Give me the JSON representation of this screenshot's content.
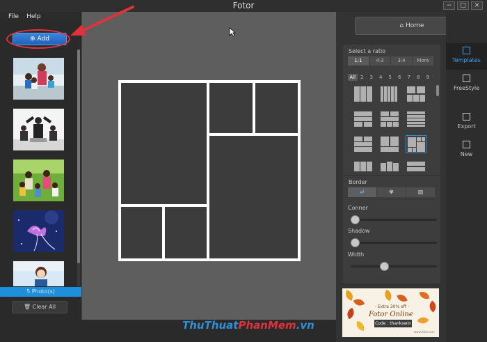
{
  "window": {
    "title": "Fotor",
    "controls": {
      "minimize": "−",
      "maximize": "□",
      "close": "×"
    }
  },
  "menu": {
    "items": [
      "File",
      "Help"
    ]
  },
  "left_panel": {
    "add_label": "Add",
    "photo_count": "5 Photo(s)",
    "clear_label": "Clear All",
    "thumbnails": [
      "family-photo",
      "business-team-photo",
      "outdoor-family-photo",
      "purple-flower-photo",
      "woman-smiling-photo"
    ]
  },
  "right_panel": {
    "home_label": "Home",
    "ratio_title": "Select a ratio",
    "ratios": [
      "1:1",
      "4:3",
      "3:4",
      "More"
    ],
    "active_ratio": "1:1",
    "counts": [
      "All",
      "2",
      "3",
      "4",
      "5",
      "6",
      "7",
      "8",
      "9"
    ],
    "active_count": "All",
    "border_title": "Border",
    "corner_label": "Conner",
    "shadow_label": "Shadow",
    "width_label": "Width",
    "corner_value": 0,
    "shadow_value": 0,
    "width_value": 0.38
  },
  "ad": {
    "tag": "- Extra 30% off -",
    "title": "Fotor Online",
    "code": "Code : thankswin",
    "url": "www.fotor.com"
  },
  "side_nav": [
    {
      "label": "Templates",
      "active": true
    },
    {
      "label": "FreeStyle",
      "active": false
    },
    {
      "label": "Export",
      "active": false
    },
    {
      "label": "New",
      "active": false
    }
  ],
  "watermark": {
    "part1": "ThuThuat",
    "part2": "PhanMem",
    "part3": ".vn"
  },
  "colors": {
    "accent": "#2b8fd8",
    "annotation_red": "#e0323c",
    "canvas": "#5e5e5e"
  }
}
